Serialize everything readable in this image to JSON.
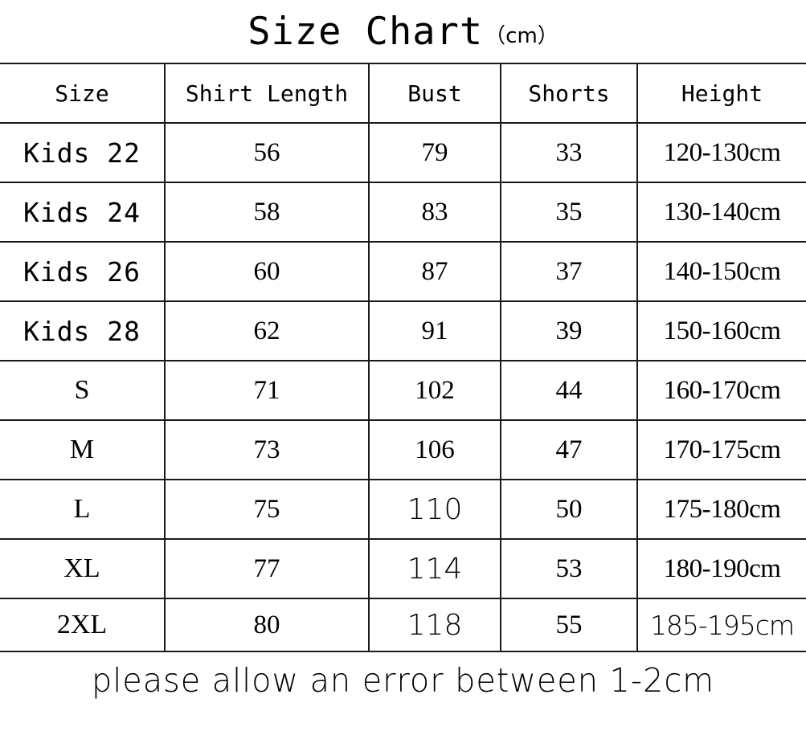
{
  "title": {
    "main": "Size Chart",
    "unit": "（cm）"
  },
  "table": {
    "headers": [
      "Size",
      "Shirt Length",
      "Bust",
      "Shorts",
      "Height"
    ],
    "rows": [
      {
        "size": "Kids 22",
        "shirt_length": "56",
        "bust": "79",
        "shorts": "33",
        "height": "120-130cm"
      },
      {
        "size": "Kids 24",
        "shirt_length": "58",
        "bust": "83",
        "shorts": "35",
        "height": "130-140cm"
      },
      {
        "size": "Kids 26",
        "shirt_length": "60",
        "bust": "87",
        "shorts": "37",
        "height": "140-150cm"
      },
      {
        "size": "Kids 28",
        "shirt_length": "62",
        "bust": "91",
        "shorts": "39",
        "height": "150-160cm"
      },
      {
        "size": "S",
        "shirt_length": "71",
        "bust": "102",
        "shorts": "44",
        "height": "160-170cm"
      },
      {
        "size": "M",
        "shirt_length": "73",
        "bust": "106",
        "shorts": "47",
        "height": "170-175cm"
      },
      {
        "size": "L",
        "shirt_length": "75",
        "bust": "110",
        "shorts": "50",
        "height": "175-180cm"
      },
      {
        "size": "XL",
        "shirt_length": "77",
        "bust": "114",
        "shorts": "53",
        "height": "180-190cm"
      },
      {
        "size": "2XL",
        "shirt_length": "80",
        "bust": "118",
        "shorts": "55",
        "height": "185-195cm"
      }
    ]
  },
  "footer": {
    "note": "please allow an error between 1-2cm"
  },
  "colors": {
    "text": "#000000",
    "border": "#1a1a1a",
    "background": "#ffffff"
  },
  "chart_data": {
    "type": "table",
    "title": "Size Chart（cm）",
    "columns": [
      "Size",
      "Shirt Length",
      "Bust",
      "Shorts",
      "Height"
    ],
    "units": "cm",
    "rows": [
      [
        "Kids 22",
        56,
        79,
        33,
        "120-130cm"
      ],
      [
        "Kids 24",
        58,
        83,
        35,
        "130-140cm"
      ],
      [
        "Kids 26",
        60,
        87,
        37,
        "140-150cm"
      ],
      [
        "Kids 28",
        62,
        91,
        39,
        "150-160cm"
      ],
      [
        "S",
        71,
        102,
        44,
        "160-170cm"
      ],
      [
        "M",
        73,
        106,
        47,
        "170-175cm"
      ],
      [
        "L",
        75,
        110,
        50,
        "175-180cm"
      ],
      [
        "XL",
        77,
        114,
        53,
        "180-190cm"
      ],
      [
        "2XL",
        80,
        118,
        55,
        "185-195cm"
      ]
    ],
    "annotations": [
      "please allow an error between 1-2cm"
    ]
  }
}
